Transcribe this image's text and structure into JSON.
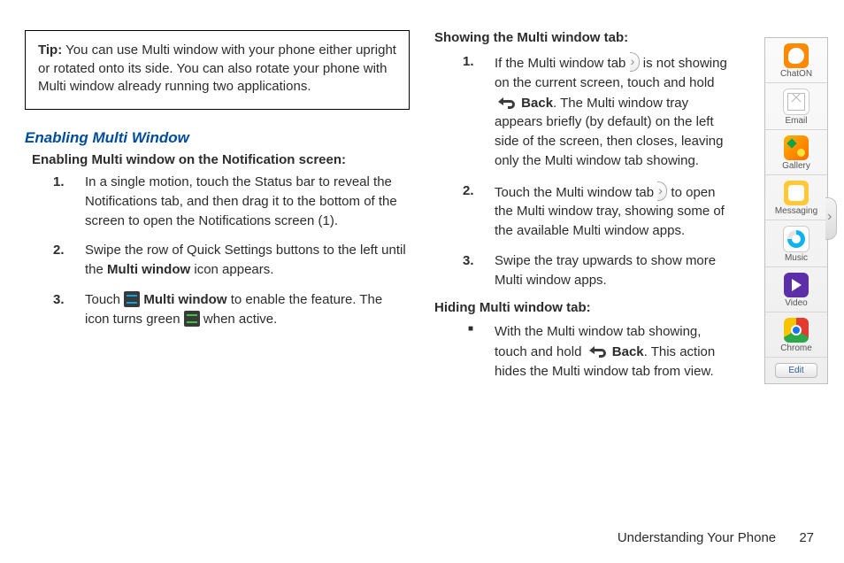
{
  "tip": {
    "prefix": "Tip:",
    "text": " You can use Multi window with your phone either upright or rotated onto its side. You can also rotate your phone with Multi window already running two applications."
  },
  "left": {
    "heading": "Enabling Multi Window",
    "subhead": "Enabling Multi window on the Notification screen:",
    "steps": {
      "s1": "In a single motion, touch the Status bar to reveal the Notifications tab, and then drag it to the bottom of the screen to open the Notifications screen (1).",
      "s2a": "Swipe the row of Quick Settings buttons to the left until the ",
      "s2b": "Multi window",
      "s2c": " icon appears.",
      "s3a": "Touch ",
      "s3b": " Multi window",
      "s3c": " to enable the feature. The icon turns green ",
      "s3d": " when active."
    }
  },
  "right": {
    "showHeading": "Showing the Multi window tab:",
    "show": {
      "s1a": "If the Multi window tab ",
      "s1b": " is not showing on the current screen, touch and hold ",
      "s1c": "Back",
      "s1d": ". The Multi window tray appears briefly (by default) on the left side of the screen, then closes, leaving only the Multi window tab showing.",
      "s2a": "Touch the Multi window tab ",
      "s2b": " to open the Multi window tray, showing some of the available Multi window apps.",
      "s3": "Swipe the tray upwards to show more Multi window apps."
    },
    "hideHeading": "Hiding Multi window tab:",
    "hide": {
      "b1a": "With the Multi window tab showing, touch and hold ",
      "b1b": "Back",
      "b1c": ". This action hides the Multi window tab from view."
    }
  },
  "tray": {
    "apps": {
      "a1": "ChatON",
      "a2": "Email",
      "a3": "Gallery",
      "a4": "Messaging",
      "a5": "Music",
      "a6": "Video",
      "a7": "Chrome"
    },
    "edit": "Edit"
  },
  "footer": {
    "section": "Understanding Your Phone",
    "page": "27"
  }
}
